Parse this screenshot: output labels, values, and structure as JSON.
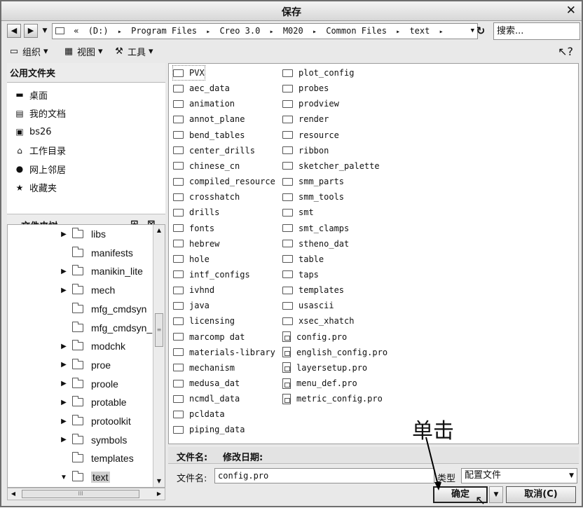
{
  "window": {
    "title": "保存",
    "close_glyph": "✕"
  },
  "address": {
    "back_glyph": "◀",
    "forward_glyph": "▶",
    "recent_glyph": "▼",
    "prefix_glyph": "«",
    "segments": [
      "(D:)",
      "Program Files",
      "Creo 3.0",
      "M020",
      "Common Files",
      "text"
    ],
    "separator_glyph": "▸",
    "dropdown_glyph": "▼",
    "refresh_glyph": "↻"
  },
  "search": {
    "placeholder": "搜索..."
  },
  "toolbar": {
    "organize_label": "组织",
    "view_label": "视图",
    "tools_label": "工具",
    "dropdown_glyph": "▾",
    "organize_icon": "▭",
    "view_icon": "▦",
    "tools_icon": "⚒",
    "cursor_icon": "↖?"
  },
  "sidebar": {
    "favorites_title": "公用文件夹",
    "favorites": [
      {
        "label": "桌面",
        "icon": "▬"
      },
      {
        "label": "我的文档",
        "icon": "▤"
      },
      {
        "label": "bs26",
        "icon": "▣"
      },
      {
        "label": "工作目录",
        "icon": "⌂"
      },
      {
        "label": "网上邻居",
        "icon": "●"
      },
      {
        "label": "收藏夹",
        "icon": "★"
      }
    ],
    "tree_title": "文件夹树",
    "tree_toggle": "▼",
    "tree_new_folder_icon": "⊞",
    "tree_delete_icon": "⊠"
  },
  "tree": {
    "items": [
      {
        "label": "libs",
        "expander": "▶"
      },
      {
        "label": "manifests",
        "expander": ""
      },
      {
        "label": "manikin_lite",
        "expander": "▶"
      },
      {
        "label": "mech",
        "expander": "▶"
      },
      {
        "label": "mfg_cmdsyn",
        "expander": ""
      },
      {
        "label": "mfg_cmdsyn_",
        "expander": ""
      },
      {
        "label": "modchk",
        "expander": "▶"
      },
      {
        "label": "proe",
        "expander": "▶"
      },
      {
        "label": "proole",
        "expander": "▶"
      },
      {
        "label": "protable",
        "expander": "▶"
      },
      {
        "label": "protoolkit",
        "expander": "▶"
      },
      {
        "label": "symbols",
        "expander": "▶"
      },
      {
        "label": "templates",
        "expander": ""
      },
      {
        "label": "text",
        "expander": "▼"
      }
    ],
    "scroll_up": "▲",
    "scroll_down": "▼",
    "scroll_left": "◀",
    "scroll_right": "▶",
    "thumb_grip": "≡",
    "hthumb_grip": "III"
  },
  "files": {
    "column1": [
      {
        "name": "PVX",
        "type": "folder"
      },
      {
        "name": "aec_data",
        "type": "folder"
      },
      {
        "name": "animation",
        "type": "folder"
      },
      {
        "name": "annot_plane",
        "type": "folder"
      },
      {
        "name": "bend_tables",
        "type": "folder"
      },
      {
        "name": "center_drills",
        "type": "folder"
      },
      {
        "name": "chinese_cn",
        "type": "folder"
      },
      {
        "name": "compiled_resource",
        "type": "folder"
      },
      {
        "name": "crosshatch",
        "type": "folder"
      },
      {
        "name": "drills",
        "type": "folder"
      },
      {
        "name": "fonts",
        "type": "folder"
      },
      {
        "name": "hebrew",
        "type": "folder"
      },
      {
        "name": "hole",
        "type": "folder"
      },
      {
        "name": "intf_configs",
        "type": "folder"
      },
      {
        "name": "ivhnd",
        "type": "folder"
      },
      {
        "name": "java",
        "type": "folder"
      },
      {
        "name": "licensing",
        "type": "folder"
      },
      {
        "name": "marcomp dat",
        "type": "folder"
      },
      {
        "name": "materials-library",
        "type": "folder"
      },
      {
        "name": "mechanism",
        "type": "folder"
      },
      {
        "name": "medusa_dat",
        "type": "folder"
      },
      {
        "name": "ncmdl_data",
        "type": "folder"
      },
      {
        "name": "pcldata",
        "type": "folder"
      },
      {
        "name": "piping_data",
        "type": "folder"
      }
    ],
    "column2": [
      {
        "name": "plot_config",
        "type": "folder"
      },
      {
        "name": "probes",
        "type": "folder"
      },
      {
        "name": "prodview",
        "type": "folder"
      },
      {
        "name": "render",
        "type": "folder"
      },
      {
        "name": "resource",
        "type": "folder"
      },
      {
        "name": "ribbon",
        "type": "folder"
      },
      {
        "name": "sketcher_palette",
        "type": "folder"
      },
      {
        "name": "smm_parts",
        "type": "folder"
      },
      {
        "name": "smm_tools",
        "type": "folder"
      },
      {
        "name": "smt",
        "type": "folder"
      },
      {
        "name": "smt_clamps",
        "type": "folder"
      },
      {
        "name": "stheno_dat",
        "type": "folder"
      },
      {
        "name": "table",
        "type": "folder"
      },
      {
        "name": "taps",
        "type": "folder"
      },
      {
        "name": "templates",
        "type": "folder"
      },
      {
        "name": "usascii",
        "type": "folder"
      },
      {
        "name": "xsec_xhatch",
        "type": "folder"
      },
      {
        "name": "config.pro",
        "type": "file"
      },
      {
        "name": "english_config.pro",
        "type": "file"
      },
      {
        "name": "layersetup.pro",
        "type": "file"
      },
      {
        "name": "menu_def.pro",
        "type": "file"
      },
      {
        "name": "metric_config.pro",
        "type": "file"
      }
    ]
  },
  "details": {
    "name_header": "文件名:",
    "modified_header": "修改日期:"
  },
  "form": {
    "filename_label": "文件名:",
    "filename_value": "config.pro",
    "type_label": "类型",
    "type_value": "配置文件",
    "type_dropdown_glyph": "▼"
  },
  "buttons": {
    "ok_label": "确定",
    "ok_dropdown_glyph": "▼",
    "cancel_label": "取消(C)"
  },
  "annotation": {
    "text": "单击"
  },
  "pointer_glyph": "↖"
}
